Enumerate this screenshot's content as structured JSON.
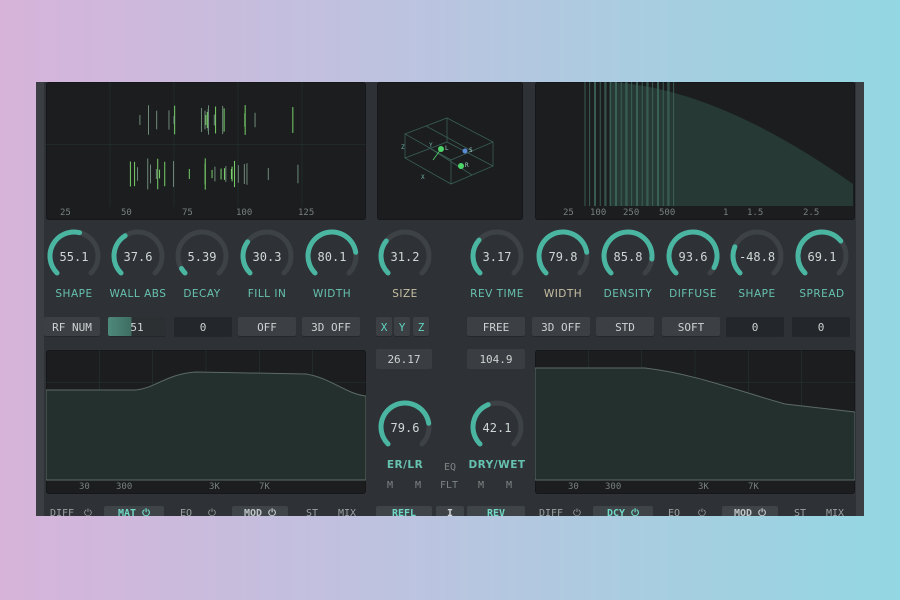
{
  "colors": {
    "accent": "#4ab6a2",
    "track": "#3d4246",
    "panel": "#1b1d1f"
  },
  "top_left_ticks": [
    "25",
    "50",
    "75",
    "100",
    "125"
  ],
  "top_right_ticks": [
    "25",
    "100",
    "250",
    "500",
    "1",
    "1.5",
    "2.5"
  ],
  "eq_ticks_left": [
    "30",
    "300",
    "3K",
    "7K"
  ],
  "eq_ticks_right": [
    "30",
    "300",
    "3K",
    "7K"
  ],
  "room_axes": {
    "x": "X",
    "y": "Y",
    "z": "Z",
    "l": "L",
    "r": "R",
    "s": "S"
  },
  "knobs_left": [
    {
      "value": "55.1",
      "label": "SHAPE",
      "fill": 0.55
    },
    {
      "value": "37.6",
      "label": "WALL ABS",
      "fill": 0.38
    },
    {
      "value": "5.39",
      "label": "DECAY",
      "fill": 0.05
    },
    {
      "value": "30.3",
      "label": "FILL IN",
      "fill": 0.3
    },
    {
      "value": "80.1",
      "label": "WIDTH",
      "fill": 0.8
    }
  ],
  "knob_size": {
    "value": "31.2",
    "label": "SIZE",
    "fill": 0.31
  },
  "knob_revtime": {
    "value": "3.17",
    "label": "REV TIME",
    "fill": 0.32
  },
  "knobs_right": [
    {
      "value": "79.8",
      "label": "WIDTH",
      "fill": 0.8
    },
    {
      "value": "85.8",
      "label": "DENSITY",
      "fill": 0.86
    },
    {
      "value": "93.6",
      "label": "DIFFUSE",
      "fill": 0.94
    },
    {
      "value": "-48.8",
      "label": "SHAPE",
      "fill": 0.25
    },
    {
      "value": "69.1",
      "label": "SPREAD",
      "fill": 0.69
    }
  ],
  "knob_erlr": {
    "value": "79.6",
    "label": "ER/LR",
    "fill": 0.8
  },
  "knob_drywet": {
    "value": "42.1",
    "label": "DRY/WET",
    "fill": 0.42
  },
  "buttons": {
    "rf_num": "RF NUM",
    "rf_val": "51",
    "zero_left": "0",
    "off": "OFF",
    "three_d_off_left": "3D OFF",
    "x": "X",
    "y": "Y",
    "z": "Z",
    "free": "FREE",
    "three_d_off_right": "3D OFF",
    "std": "STD",
    "soft": "SOFT",
    "zero_right_a": "0",
    "zero_right_b": "0"
  },
  "value_boxes": {
    "size_val": "26.17",
    "rev_val": "104.9"
  },
  "center_small": {
    "eq": "EQ",
    "flt": "FLT",
    "m1": "M",
    "m2": "M",
    "m3": "M",
    "m4": "M"
  },
  "bottom_left": [
    "DIFF",
    "MAT",
    "EQ",
    "MOD",
    "ST",
    "MIX"
  ],
  "bottom_center": [
    "REFL",
    "I",
    "REV"
  ],
  "bottom_right": [
    "DIFF",
    "DCY",
    "EQ",
    "MOD",
    "ST",
    "MIX"
  ]
}
